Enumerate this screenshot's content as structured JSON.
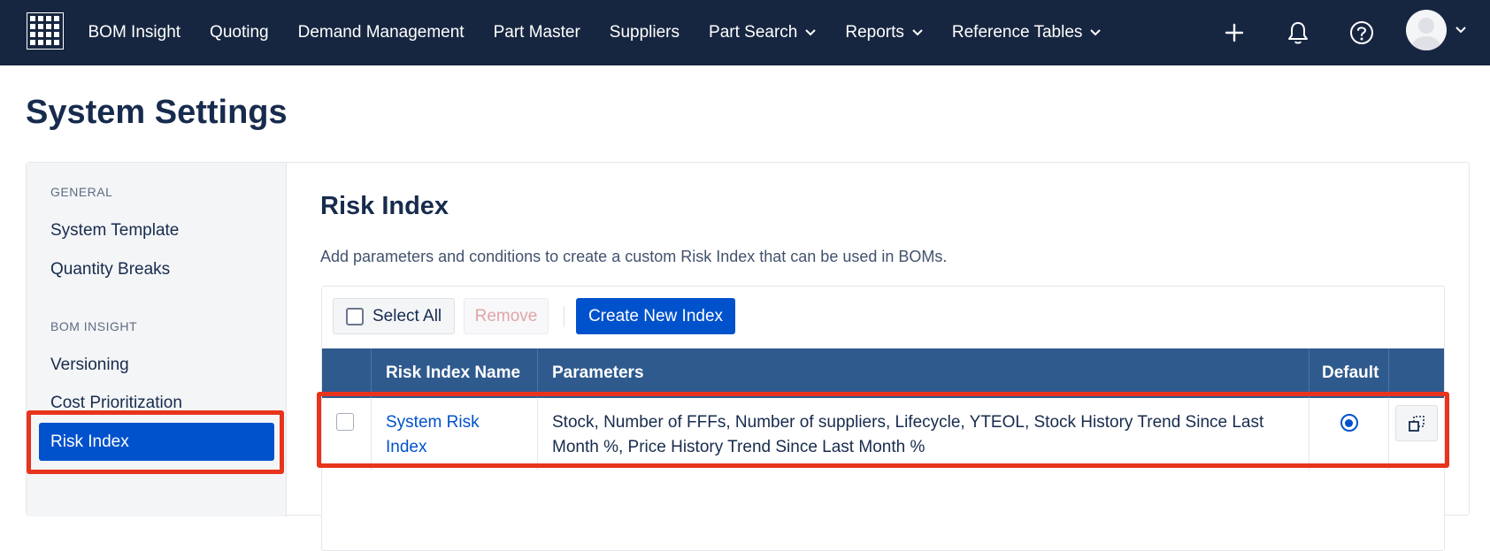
{
  "topnav": {
    "items": [
      {
        "label": "BOM Insight",
        "dropdown": false
      },
      {
        "label": "Quoting",
        "dropdown": false
      },
      {
        "label": "Demand Management",
        "dropdown": false
      },
      {
        "label": "Part Master",
        "dropdown": false
      },
      {
        "label": "Suppliers",
        "dropdown": false
      },
      {
        "label": "Part Search",
        "dropdown": true
      },
      {
        "label": "Reports",
        "dropdown": true
      },
      {
        "label": "Reference Tables",
        "dropdown": true
      }
    ],
    "icons": [
      "app-grid-icon",
      "plus-icon",
      "bell-icon",
      "help-icon",
      "avatar",
      "chevron-down-icon"
    ]
  },
  "page": {
    "title": "System Settings"
  },
  "sidebar": {
    "sections": [
      {
        "heading": "GENERAL",
        "items": [
          "System Template",
          "Quantity Breaks"
        ]
      },
      {
        "heading": "BOM INSIGHT",
        "items": [
          "Versioning",
          "Cost Prioritization",
          "Risk Index"
        ]
      }
    ],
    "active": "Risk Index"
  },
  "content": {
    "title": "Risk Index",
    "description": "Add parameters and conditions to create a custom Risk Index that can be used in BOMs.",
    "toolbar": {
      "select_all": "Select All",
      "remove": "Remove",
      "create": "Create New Index"
    },
    "table": {
      "columns": [
        "",
        "Risk Index Name",
        "Parameters",
        "Default",
        ""
      ],
      "rows": [
        {
          "name": "System Risk Index",
          "parameters": "Stock, Number of FFFs, Number of suppliers, Lifecycle, YTEOL, Stock History Trend Since Last Month %, Price History Trend Since Last Month %",
          "default": true
        }
      ]
    }
  },
  "colors": {
    "nav_bg": "#172640",
    "accent": "#0052cc",
    "table_header": "#2f5a8e",
    "highlight": "#e8341c"
  }
}
